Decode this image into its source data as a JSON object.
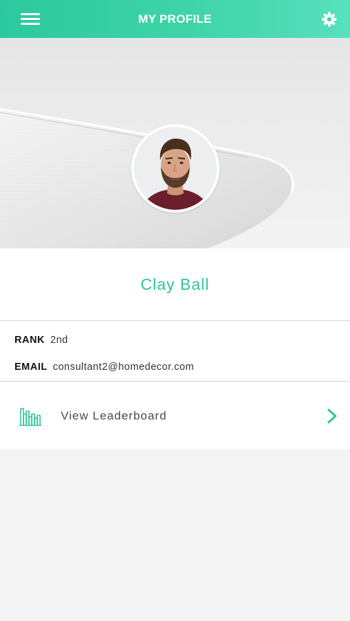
{
  "header": {
    "title": "MY PROFILE",
    "menu_icon": "hamburger-menu-icon",
    "settings_icon": "gear-icon"
  },
  "profile": {
    "name": "Clay Ball",
    "avatar": "user-avatar"
  },
  "details": {
    "rank_label": "RANK",
    "rank_value": "2nd",
    "email_label": "EMAIL",
    "email_value": "consultant2@homedecor.com"
  },
  "leaderboard": {
    "label": "View Leaderboard",
    "icon": "bar-chart-icon",
    "chevron_icon": "chevron-right-icon"
  },
  "colors": {
    "accent": "#2ec59c",
    "header_start": "#2cc99e",
    "header_end": "#58e0bd",
    "background": "#f4f4f4"
  }
}
